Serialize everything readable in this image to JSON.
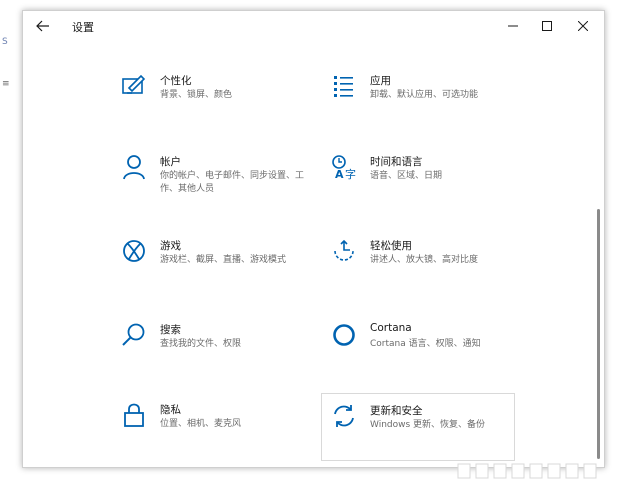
{
  "window": {
    "title": "设置",
    "controls": {
      "minimize": "—",
      "maximize": "☐",
      "close": "✕"
    }
  },
  "tiles": [
    {
      "title": "个性化",
      "desc": "背景、锁屏、颜色",
      "icon": "personalization-icon"
    },
    {
      "title": "应用",
      "desc": "卸载、默认应用、可选功能",
      "icon": "apps-list-icon"
    },
    {
      "title": "帐户",
      "desc": "你的帐户、电子邮件、同步设置、工作、其他人员",
      "icon": "person-icon"
    },
    {
      "title": "时间和语言",
      "desc": "语音、区域、日期",
      "icon": "time-language-icon"
    },
    {
      "title": "游戏",
      "desc": "游戏栏、截屏、直播、游戏模式",
      "icon": "xbox-icon"
    },
    {
      "title": "轻松使用",
      "desc": "讲述人、放大镜、高对比度",
      "icon": "ease-of-access-icon"
    },
    {
      "title": "搜索",
      "desc": "查找我的文件、权限",
      "icon": "search-icon"
    },
    {
      "title": "Cortana",
      "desc": "Cortana 语言、权限、通知",
      "icon": "cortana-icon"
    },
    {
      "title": "隐私",
      "desc": "位置、相机、麦克风",
      "icon": "lock-icon"
    },
    {
      "title": "更新和安全",
      "desc": "Windows 更新、恢复、备份",
      "icon": "update-sync-icon"
    }
  ],
  "colors": {
    "accent": "#0063b1",
    "title_text": "#1a1a1a",
    "desc_text": "#6b6b6b"
  }
}
